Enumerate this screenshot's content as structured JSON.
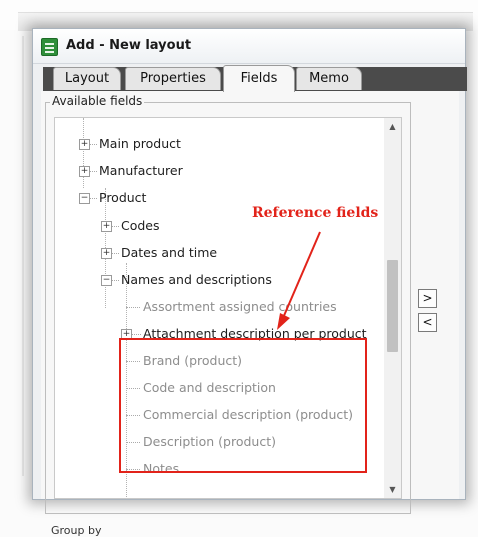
{
  "window": {
    "title": "Add - New layout"
  },
  "tabs": [
    {
      "label": "Layout"
    },
    {
      "label": "Properties"
    },
    {
      "label": "Fields"
    },
    {
      "label": "Memo"
    }
  ],
  "available_fields": {
    "legend": "Available fields",
    "items": [
      {
        "label": "Main product",
        "expander": "+"
      },
      {
        "label": "Manufacturer",
        "expander": "+"
      },
      {
        "label": "Product",
        "expander": "−"
      },
      {
        "label": "Codes",
        "expander": "+"
      },
      {
        "label": "Dates and time",
        "expander": "+"
      },
      {
        "label": "Names and descriptions",
        "expander": "−"
      },
      {
        "label": "Assortment assigned countries",
        "expander": ""
      },
      {
        "label": "Attachment description per product",
        "expander": "+"
      },
      {
        "label": "Brand (product)",
        "expander": ""
      },
      {
        "label": "Code and description",
        "expander": ""
      },
      {
        "label": "Commercial description (product)",
        "expander": ""
      },
      {
        "label": "Description (product)",
        "expander": ""
      },
      {
        "label": "Notes",
        "expander": ""
      }
    ]
  },
  "buttons": {
    "add": ">",
    "remove": "<"
  },
  "scroll": {
    "up": "▲",
    "down": "▼"
  },
  "bottom_label": "Group by",
  "annotation": {
    "text": "Reference fields",
    "color": "#e2231a"
  }
}
